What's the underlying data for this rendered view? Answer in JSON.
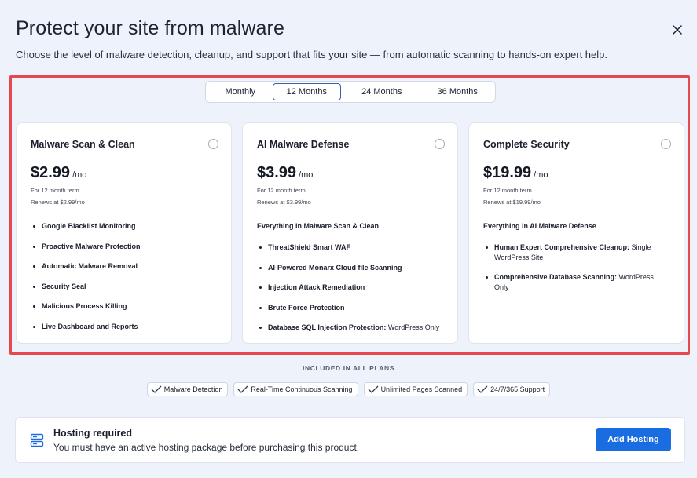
{
  "modal": {
    "title": "Protect your site from malware",
    "subtitle": "Choose the level of malware detection, cleanup, and support that fits your site — from automatic scanning to hands-on expert help."
  },
  "term_tabs": {
    "selected": "12 Months",
    "items": [
      {
        "label": "Monthly"
      },
      {
        "label": "12 Months"
      },
      {
        "label": "24 Months"
      },
      {
        "label": "36 Months"
      }
    ]
  },
  "plans": [
    {
      "name": "Malware Scan & Clean",
      "price": "$2.99",
      "per": "/mo",
      "term": "For 12 month term",
      "renews": "Renews at $2.99/mo",
      "features": [
        {
          "bold": "Google Blacklist Monitoring",
          "plain": ""
        },
        {
          "bold": "Proactive Malware Protection",
          "plain": ""
        },
        {
          "bold": "Automatic Malware Removal",
          "plain": ""
        },
        {
          "bold": "Security Seal",
          "plain": ""
        },
        {
          "bold": "Malicious Process Killing",
          "plain": ""
        },
        {
          "bold": "Live Dashboard and Reports",
          "plain": ""
        }
      ]
    },
    {
      "name": "AI Malware Defense",
      "price": "$3.99",
      "per": "/mo",
      "term": "For 12 month term",
      "renews": "Renews at $3.99/mo",
      "lead": "Everything in Malware Scan & Clean",
      "features": [
        {
          "bold": "ThreatShield Smart WAF",
          "plain": ""
        },
        {
          "bold": "AI-Powered Monarx Cloud file Scanning",
          "plain": ""
        },
        {
          "bold": "Injection Attack Remediation",
          "plain": ""
        },
        {
          "bold": "Brute Force Protection",
          "plain": ""
        },
        {
          "bold": "Database SQL Injection Protection:",
          "plain": " WordPress Only"
        }
      ]
    },
    {
      "name": "Complete Security",
      "price": "$19.99",
      "per": "/mo",
      "term": "For 12 month term",
      "renews": "Renews at $19.99/mo",
      "lead": "Everything in AI Malware Defense",
      "features": [
        {
          "bold": "Human Expert Comprehensive Cleanup:",
          "plain": " Single WordPress Site"
        },
        {
          "bold": "Comprehensive Database Scanning:",
          "plain": " WordPress Only"
        }
      ]
    }
  ],
  "included": {
    "heading": "INCLUDED IN ALL PLANS",
    "items": [
      {
        "label": "Malware Detection"
      },
      {
        "label": "Real-Time Continuous Scanning"
      },
      {
        "label": "Unlimited Pages Scanned"
      },
      {
        "label": "24/7/365 Support"
      }
    ]
  },
  "hosting": {
    "title": "Hosting required",
    "description": "You must have an active hosting package before purchasing this product.",
    "button_label": "Add Hosting"
  },
  "colors": {
    "accent": "#1a6de0",
    "highlight_border": "#e5484d",
    "selected_tab_border": "#3b5ea8",
    "background": "#edf2fb"
  },
  "icons": {
    "close": "close-icon",
    "check": "check-icon",
    "hosting": "server-icon"
  }
}
